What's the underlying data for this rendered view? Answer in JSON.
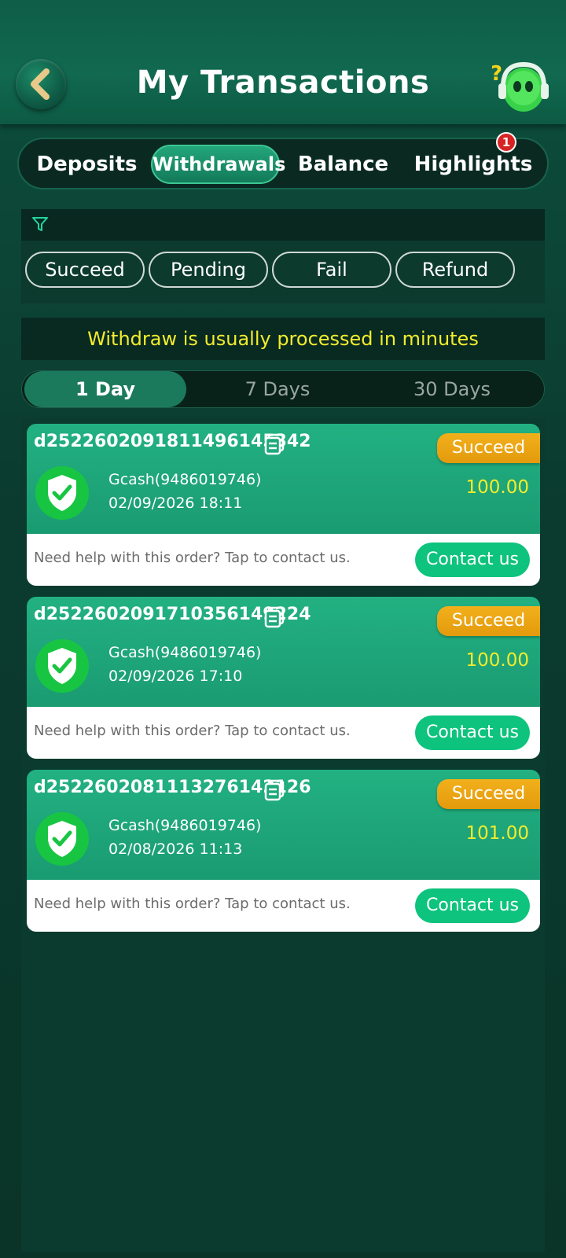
{
  "header": {
    "title": "My Transactions"
  },
  "main_tabs": [
    {
      "label": "Deposits",
      "active": false
    },
    {
      "label": "Withdrawals",
      "active": true
    },
    {
      "label": "Balance",
      "active": false
    },
    {
      "label": "Highlights",
      "active": false
    }
  ],
  "highlights_badge": "1",
  "filters": [
    "Succeed",
    "Pending",
    "Fail",
    "Refund"
  ],
  "notice": "Withdraw is usually processed in minutes",
  "day_tabs": [
    {
      "label": "1 Day",
      "active": true
    },
    {
      "label": "7 Days",
      "active": false
    },
    {
      "label": "30 Days",
      "active": false
    }
  ],
  "transactions": [
    {
      "order_id": "d252260209181149614534 2",
      "status": "Succeed",
      "method": "Gcash(9486019746)",
      "datetime": "02/09/2026 18:11",
      "amount": "100.00",
      "help_text": "Need help with this order? Tap to contact us.",
      "contact_label": "Contact us"
    },
    {
      "order_id": "d2522602091710356149224",
      "status": "Succeed",
      "method": "Gcash(9486019746)",
      "datetime": "02/09/2026 17:10",
      "amount": "100.00",
      "help_text": "Need help with this order? Tap to contact us.",
      "contact_label": "Contact us"
    },
    {
      "order_id": "d2522602081113276142126",
      "status": "Succeed",
      "method": "Gcash(9486019746)",
      "datetime": "02/08/2026 11:13",
      "amount": "101.00",
      "help_text": "Need help with this order? Tap to contact us.",
      "contact_label": "Contact us"
    }
  ],
  "colors": {
    "accent_green": "#0ec37d",
    "status_orange": "#e9a313",
    "amount_yellow": "#f3ec2d"
  }
}
